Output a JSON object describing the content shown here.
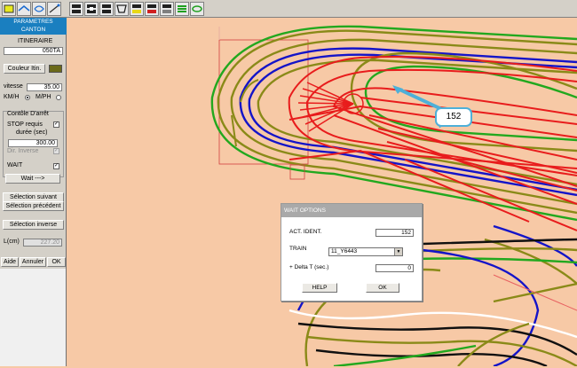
{
  "toolbar": {
    "buttons": [
      {
        "icon": "pointer-icon",
        "active": false
      },
      {
        "icon": "track-select-icon",
        "active": false
      },
      {
        "icon": "route-icon",
        "active": false
      },
      {
        "icon": "signal-icon",
        "active": false
      },
      {
        "icon": "block-canton-icon",
        "active": true
      },
      {
        "icon": "block-detect-icon",
        "active": true
      },
      {
        "icon": "switch-icon",
        "active": false
      },
      {
        "icon": "train-icon",
        "active": false
      },
      {
        "icon": "block-yellow-icon",
        "active": false
      },
      {
        "icon": "block-red-icon",
        "active": false
      },
      {
        "icon": "block-gray-icon",
        "active": false
      },
      {
        "icon": "layers-icon",
        "active": false
      },
      {
        "icon": "loop-icon",
        "active": false
      }
    ]
  },
  "panel": {
    "title_line1": "PARAMETRES",
    "title_line2": "CANTON",
    "itineraire_label": "ITINERAIRE",
    "itineraire_value": "050TA",
    "couleur_label": "Couleur Itin.",
    "couleur_color": "#6b6a1a",
    "vitesse_label": "vitesse",
    "vitesse_value": "35.00",
    "kmh_label": "KM/H",
    "mph_label": "M/PH",
    "controle_label": "Contôle D'arrêt",
    "stop_label": "STOP requis",
    "duree_label": "durée (sec)",
    "duree_value": "300.00",
    "dir_inverse_label": "Dir. Inverse",
    "wait_label": "WAIT",
    "wait_button": "Wait --->",
    "sel_suivant": "Sélection suivant",
    "sel_precedent": "Sélection précédent",
    "sel_inverse": "Sélection inverse",
    "l_label": "L(cm)",
    "l_value": "227.20",
    "aide": "Aide",
    "annuler": "Annuler",
    "ok": "OK"
  },
  "canvas": {
    "callout_value": "152"
  },
  "dialog": {
    "title": "WAIT OPTIONS",
    "act_ident_label": "ACT. IDENT.",
    "act_ident_value": "152",
    "train_label": "TRAIN",
    "train_value": "11_Y6443",
    "delta_label": "+ Delta T (sec.)",
    "delta_value": "0",
    "help_button": "HELP",
    "ok_button": "OK"
  },
  "colors": {
    "background": "#f7c9a6",
    "track_red": "#e81c1c",
    "track_blue": "#1414c8",
    "track_green": "#22a81e",
    "track_olive": "#8a8a18",
    "track_black": "#101010",
    "accent": "#1a7fc0",
    "callout_border": "#4eb0d8"
  }
}
